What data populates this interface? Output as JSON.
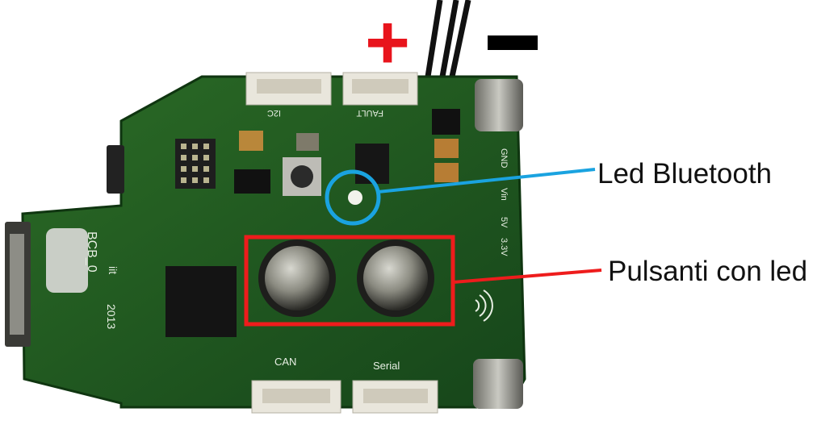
{
  "polarity": {
    "plus_symbol": "+",
    "minus_symbol": "−"
  },
  "annotations": {
    "led_bluetooth": "Led Bluetooth",
    "pulsanti_con_led": "Pulsanti con led"
  },
  "board_silkscreen": {
    "board_id": "BCB_0",
    "year": "2013",
    "logo_text": "iit",
    "connector_i2c": "I2C",
    "connector_fault": "FAULT",
    "connector_can": "CAN",
    "connector_serial": "Serial",
    "pin_gnd": "GND",
    "pin_vin": "Vin",
    "pin_5v": "5V",
    "pin_3v3": "3.3V"
  },
  "colors": {
    "board_green": "#1f5a20",
    "plus_red": "#e8141c",
    "bluetooth_marker": "#1aa3e0",
    "button_marker": "#ee1c1c"
  }
}
